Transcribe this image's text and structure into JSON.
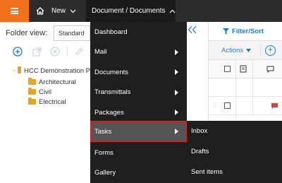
{
  "topbar": {
    "new_label": "New",
    "breadcrumb_label": "Document / Documents"
  },
  "left_panel": {
    "folder_view_label": "Folder view:",
    "folder_view_value": "Standard",
    "tree": {
      "root": "HCC Demonstration P",
      "children": [
        "Architectural",
        "Civil",
        "Electrical"
      ]
    }
  },
  "right_panel": {
    "filter_label": "Filter/Sort",
    "actions_label": "Actions"
  },
  "document_menu": {
    "items": [
      {
        "label": "Dashboard",
        "has_submenu": false
      },
      {
        "label": "Mail",
        "has_submenu": true
      },
      {
        "label": "Documents",
        "has_submenu": true
      },
      {
        "label": "Transmittals",
        "has_submenu": true
      },
      {
        "label": "Packages",
        "has_submenu": true
      },
      {
        "label": "Tasks",
        "has_submenu": true,
        "highlighted": true
      },
      {
        "label": "Forms",
        "has_submenu": false
      },
      {
        "label": "Gallery",
        "has_submenu": false
      }
    ]
  },
  "tasks_submenu": {
    "items": [
      "Inbox",
      "Drafts",
      "Sent items"
    ]
  },
  "colors": {
    "accent_orange": "#f2711c",
    "link_blue": "#1b7fd1",
    "highlight_red": "#d42020",
    "folder_yellow": "#e0a52a"
  }
}
